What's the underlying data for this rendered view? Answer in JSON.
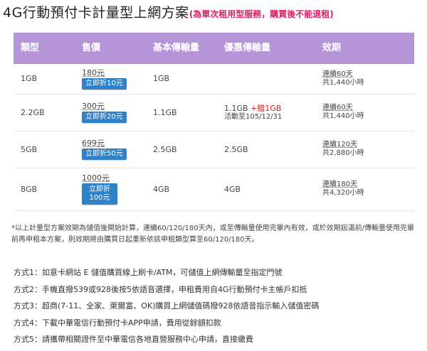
{
  "title": {
    "main": "4G行動預付卡計量型上網方案",
    "note": "(為單次租用型服務，購買後不能退租)"
  },
  "table": {
    "headers": [
      "類型",
      "售價",
      "基本傳輸量",
      "優惠傳輸量",
      "效期"
    ],
    "rows": [
      {
        "type": "1GB",
        "price": "180元",
        "discount": "立即折10元",
        "basic": "1GB",
        "promo_main": "",
        "promo_extra": "",
        "promo_sub": "",
        "valid_1": "連續60天",
        "valid_2": "共1,440小時"
      },
      {
        "type": "2.2GB",
        "price": "300元",
        "discount": "立即折20元",
        "basic": "1.1GB",
        "promo_main": "1.1GB",
        "promo_extra": "+贈1GB",
        "promo_sub": "活動至105/12/31",
        "valid_1": "連續60天",
        "valid_2": "共1,440小時"
      },
      {
        "type": "5GB",
        "price": "699元",
        "discount": "立即折50元",
        "basic": "2.5GB",
        "promo_main": "2.5GB",
        "promo_extra": "",
        "promo_sub": "",
        "valid_1": "連續120天",
        "valid_2": "共2,880小時"
      },
      {
        "type": "8GB",
        "price": "1000元",
        "discount": "立即折100元",
        "basic": "4GB",
        "promo_main": "4GB",
        "promo_extra": "",
        "promo_sub": "",
        "valid_1": "連續180天",
        "valid_2": "共4,320小時"
      }
    ]
  },
  "footnote": "*以上計量型方案效期為儲值後開始計算，連續60/120/180天內，或至傳輸量使用完畢內有效，或於效期屆滿前/傳輸量使用完畢前再申租本方案，則效期將由購買日起重新依該申租類型算至60/120/180天。",
  "methods": [
    "方式1：如意卡網站 E 儲值購買線上刷卡/ATM，可儲值上網傳輸量至指定門號",
    "方式2：手機直撥539或928後按5依語音選擇，申租費用自4G行動預付卡主帳戶扣抵",
    "方式3：超商(7-11、全家、萊爾富、OK)購買上網儲值碼撥928依語音指示輸入儲值密碼",
    "方式4：下載中華電信行動預付卡APP申請，費用從餘額扣款",
    "方式5：請攜帶相關證件至中華電信各地直營服務中心申請，直接繳費"
  ],
  "colors": {
    "header_bg": "#b594d8",
    "button_bg": "#2f82c8",
    "note_red": "#d91e63",
    "promo_red": "#e02020"
  }
}
